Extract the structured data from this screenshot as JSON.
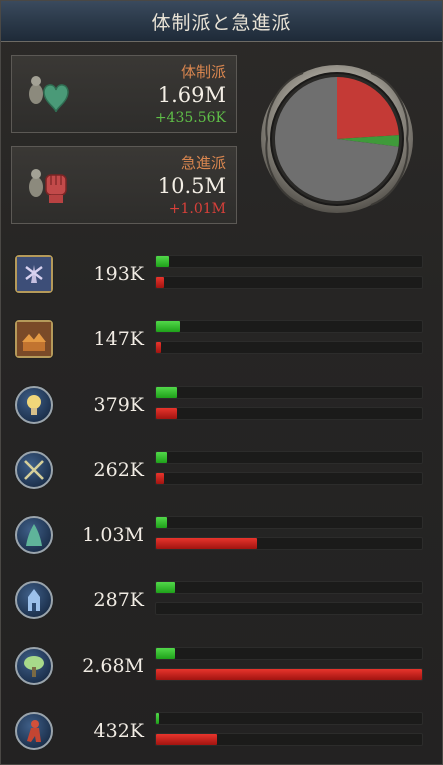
{
  "window": {
    "title": "体制派と急進派"
  },
  "loyalists": {
    "label": "体制派",
    "value": "1.69M",
    "change": "+435.56K",
    "icon": "heart-hand-icon"
  },
  "radicals": {
    "label": "急進派",
    "value": "10.5M",
    "change": "+1.01M",
    "icon": "raised-fist-icon"
  },
  "pie": {
    "share_loyalists": 0.03,
    "share_radicals": 0.24,
    "colors": {
      "neutral": "#6f6f6f",
      "loyalists": "#3f9a3a",
      "radicals": "#c43a36"
    }
  },
  "strata": [
    {
      "icon": "windmill-icon",
      "value": "193K",
      "loyalist_fraction": 0.05,
      "radical_fraction": 0.03
    },
    {
      "icon": "village-icon",
      "value": "147K",
      "loyalist_fraction": 0.09,
      "radical_fraction": 0.02
    },
    {
      "icon": "lightbulb-icon",
      "value": "379K",
      "loyalist_fraction": 0.08,
      "radical_fraction": 0.08
    },
    {
      "icon": "crossed-swords-icon",
      "value": "262K",
      "loyalist_fraction": 0.04,
      "radical_fraction": 0.03
    },
    {
      "icon": "cloaked-figure-icon",
      "value": "1.03M",
      "loyalist_fraction": 0.04,
      "radical_fraction": 0.38
    },
    {
      "icon": "church-icon",
      "value": "287K",
      "loyalist_fraction": 0.07,
      "radical_fraction": 0.0
    },
    {
      "icon": "tree-icon",
      "value": "2.68M",
      "loyalist_fraction": 0.07,
      "radical_fraction": 1.0
    },
    {
      "icon": "worker-icon",
      "value": "432K",
      "loyalist_fraction": 0.01,
      "radical_fraction": 0.23
    }
  ]
}
